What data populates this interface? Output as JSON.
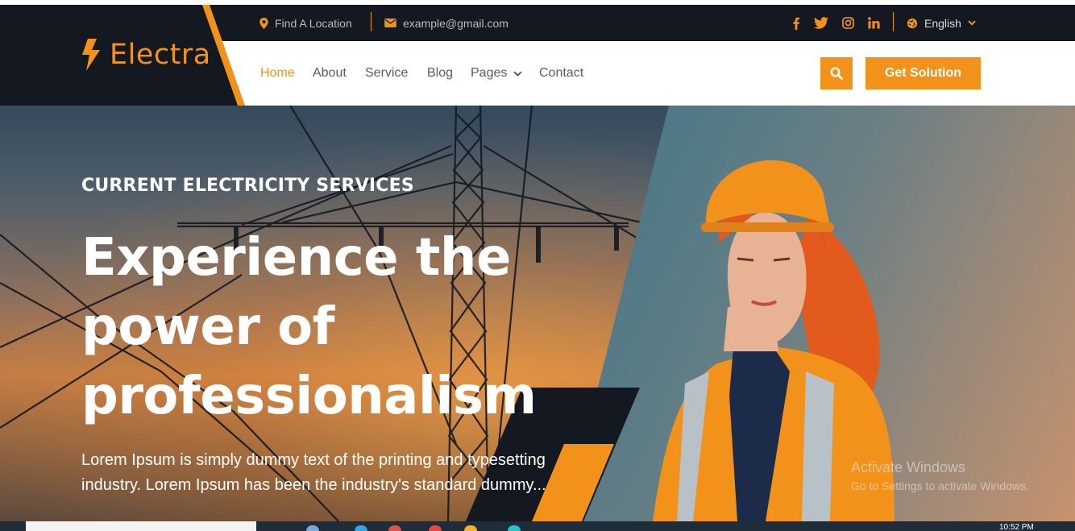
{
  "brand": {
    "name": "Electra",
    "accent": "#f2921b",
    "dark": "#141821"
  },
  "topbar": {
    "location_label": "Find A Location",
    "email_label": "example@gmail.com",
    "language": "English",
    "social_icons": [
      "facebook-icon",
      "twitter-icon",
      "instagram-icon",
      "linkedin-icon"
    ]
  },
  "nav": {
    "items": [
      {
        "label": "Home",
        "active": true
      },
      {
        "label": "About"
      },
      {
        "label": "Service"
      },
      {
        "label": "Blog"
      },
      {
        "label": "Pages",
        "has_dropdown": true
      },
      {
        "label": "Contact"
      }
    ],
    "cta_label": "Get Solution"
  },
  "hero": {
    "kicker": "CURRENT ELECTRICITY SERVICES",
    "headline": "Experience the power of professionalism",
    "description": "Lorem Ipsum is simply dummy text of the printing and typesetting industry. Lorem Ipsum has been the industry's standard dummy..."
  },
  "overlay": {
    "activate_title": "Activate Windows",
    "activate_sub": "Go to Settings to activate Windows."
  },
  "taskbar": {
    "clock": "10:52 PM"
  }
}
